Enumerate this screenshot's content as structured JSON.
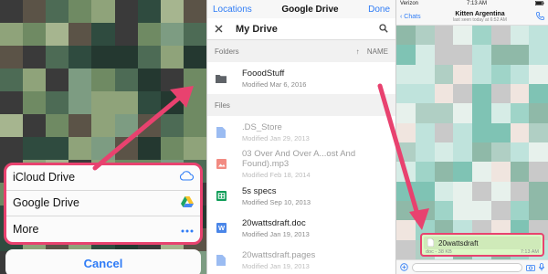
{
  "action_sheet": {
    "items": [
      {
        "label": "iCloud Drive",
        "icon": "cloud-icon"
      },
      {
        "label": "Google Drive",
        "icon": "google-drive-icon"
      },
      {
        "label": "More",
        "icon": "more-dots-icon"
      }
    ],
    "cancel_label": "Cancel",
    "highlight_color": "#e8426f",
    "accent_color": "#2f7cf6"
  },
  "drive": {
    "nav": {
      "left": "Locations",
      "title": "Google Drive",
      "right": "Done"
    },
    "header_title": "My Drive",
    "folders_label": "Folders",
    "sort_label": "NAME",
    "folders": [
      {
        "name": "FooodStuff",
        "meta": "Modified Mar 6, 2016",
        "icon": "folder-icon"
      }
    ],
    "files_label": "Files",
    "files": [
      {
        "name": ".DS_Store",
        "meta": "Modified Jan 29, 2013",
        "icon": "file-icon",
        "dim": true
      },
      {
        "name": "03 Over And Over A...ost And Found).mp3",
        "meta": "Modified Feb 18, 2014",
        "icon": "image-file-icon",
        "dim": true
      },
      {
        "name": "5s specs",
        "meta": "Modified Sep 10, 2013",
        "icon": "sheets-icon",
        "dim": false
      },
      {
        "name": "20wattsdraft.doc",
        "meta": "Modified Jan 19, 2013",
        "icon": "word-doc-icon",
        "dim": false
      },
      {
        "name": "20wattsdraft.pages",
        "meta": "Modified Jan 19, 2013",
        "icon": "file-icon",
        "dim": true
      }
    ]
  },
  "chat": {
    "status": {
      "carrier": "Verizon",
      "time": "7:13 AM"
    },
    "back_label": "Chats",
    "contact_name": "Kitten Argentina",
    "last_seen": "last seen today at 6:52 AM",
    "attachment": {
      "name": "20wattsdraft",
      "meta": "doc - 38 KB",
      "time": "7:13 AM"
    }
  }
}
